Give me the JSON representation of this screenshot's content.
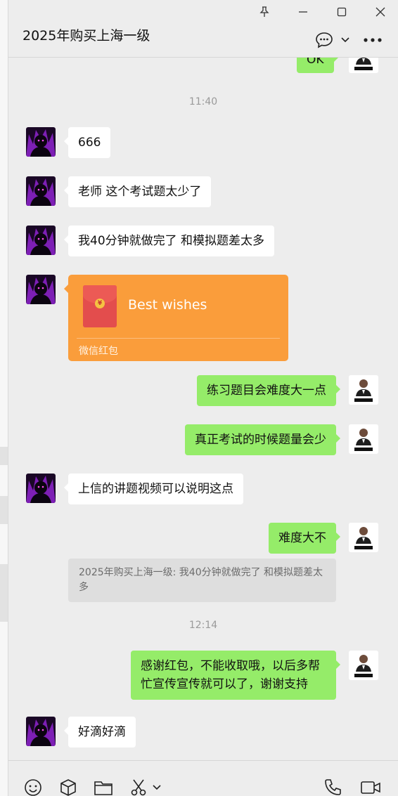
{
  "window": {
    "title": "2025年购买上海一级"
  },
  "chat": {
    "partial_top_message": "OK",
    "time_1": "11:40",
    "msg_1": "666",
    "msg_2": "老师 这个考试题太少了",
    "msg_3": "我40分钟就做完了 和模拟题差太多",
    "red_packet": {
      "title": "Best wishes",
      "footer": "微信红包"
    },
    "msg_4": "练习题目会难度大一点",
    "msg_5": "真正考试的时候题量会少",
    "msg_6": "上信的讲题视频可以说明这点",
    "msg_7": "难度大不",
    "quote": "2025年购买上海一级: 我40分钟就做完了 和模拟题差太多",
    "time_2": "12:14",
    "msg_8": "感谢红包，不能收取哦，以后多帮忙宣传宣传就可以了，谢谢支持",
    "msg_9": "好滴好滴"
  },
  "colors": {
    "background": "#ededed",
    "bubble_green": "#95ec69",
    "bubble_white": "#ffffff",
    "red_packet": "#fa9d3b"
  },
  "icons": {
    "titlebar": [
      "pin-icon",
      "minimize-icon",
      "maximize-icon",
      "close-icon"
    ],
    "header": [
      "chat-bubble-icon",
      "chevron-down-icon",
      "more-icon"
    ],
    "toolbar": [
      "emoji-icon",
      "package-icon",
      "folder-icon",
      "scissors-icon",
      "chevron-down-icon",
      "phone-icon",
      "video-icon"
    ]
  }
}
